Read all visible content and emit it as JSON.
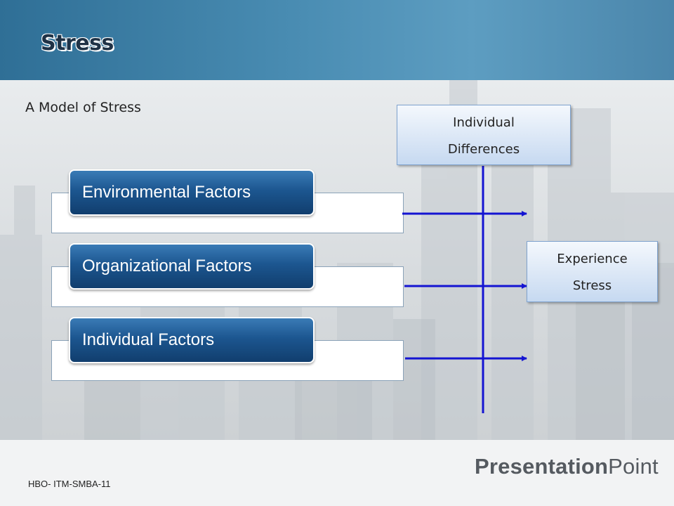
{
  "slide": {
    "title": "Stress",
    "subtitle": "A  Model of Stress",
    "footer": "HBO- ITM-SMBA-11"
  },
  "brand": {
    "bold": "Presentation",
    "light": "Point"
  },
  "diagram": {
    "factors": [
      {
        "label": "Environmental Factors"
      },
      {
        "label": "Organizational Factors"
      },
      {
        "label": "Individual Factors"
      }
    ],
    "moderator": {
      "line1": "Individual",
      "line2": "Differences"
    },
    "outcome": {
      "line1": "Experience",
      "line2": "Stress"
    }
  },
  "colors": {
    "header": "#3f82aa",
    "factor_fill": "#1c5690",
    "arrow": "#1414d2",
    "box_fill": "#dbe7f6"
  }
}
